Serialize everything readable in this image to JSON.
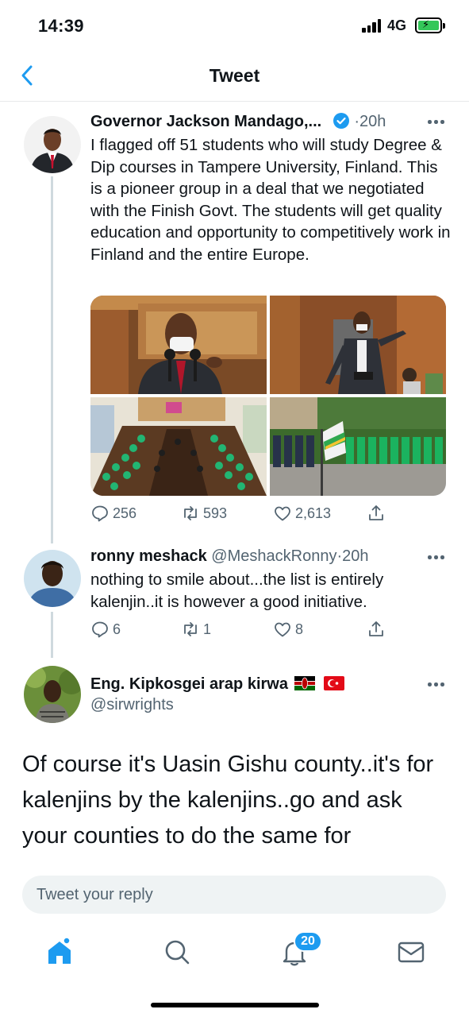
{
  "status_bar": {
    "time": "14:39",
    "network": "4G"
  },
  "header": {
    "title": "Tweet"
  },
  "main_tweet": {
    "author_name": "Governor Jackson Mandago,...",
    "separator": "·",
    "time": "20h",
    "text": "I flagged off 51 students who will study Degree & Dip courses in Tampere University, Finland. This is a pioneer group in a deal that we negotiated with the Finish Govt. The students will get quality education and opportunity to competitively work in Finland and the entire Europe.",
    "stats": {
      "replies": "256",
      "retweets": "593",
      "likes": "2,613"
    }
  },
  "reply_1": {
    "author_name": "ronny meshack",
    "handle": "@MeshackRonny",
    "separator": "·",
    "time": "20h",
    "text": "nothing to smile about...the list is entirely kalenjin..it is however a good initiative.",
    "stats": {
      "replies": "6",
      "retweets": "1",
      "likes": "8"
    }
  },
  "reply_2": {
    "author_name": "Eng. Kipkosgei arap kirwa",
    "handle": "@sirwrights",
    "text": "Of course it's Uasin Gishu county..it's for kalenjins by the kalenjins..go and ask your counties to do the same for"
  },
  "compose": {
    "placeholder": "Tweet your reply"
  },
  "tab_bar": {
    "notification_count": "20"
  },
  "colors": {
    "accent": "#1d9bf0",
    "verified": "#1d9bf0",
    "muted": "#536471",
    "divider": "#e7e9eb"
  }
}
